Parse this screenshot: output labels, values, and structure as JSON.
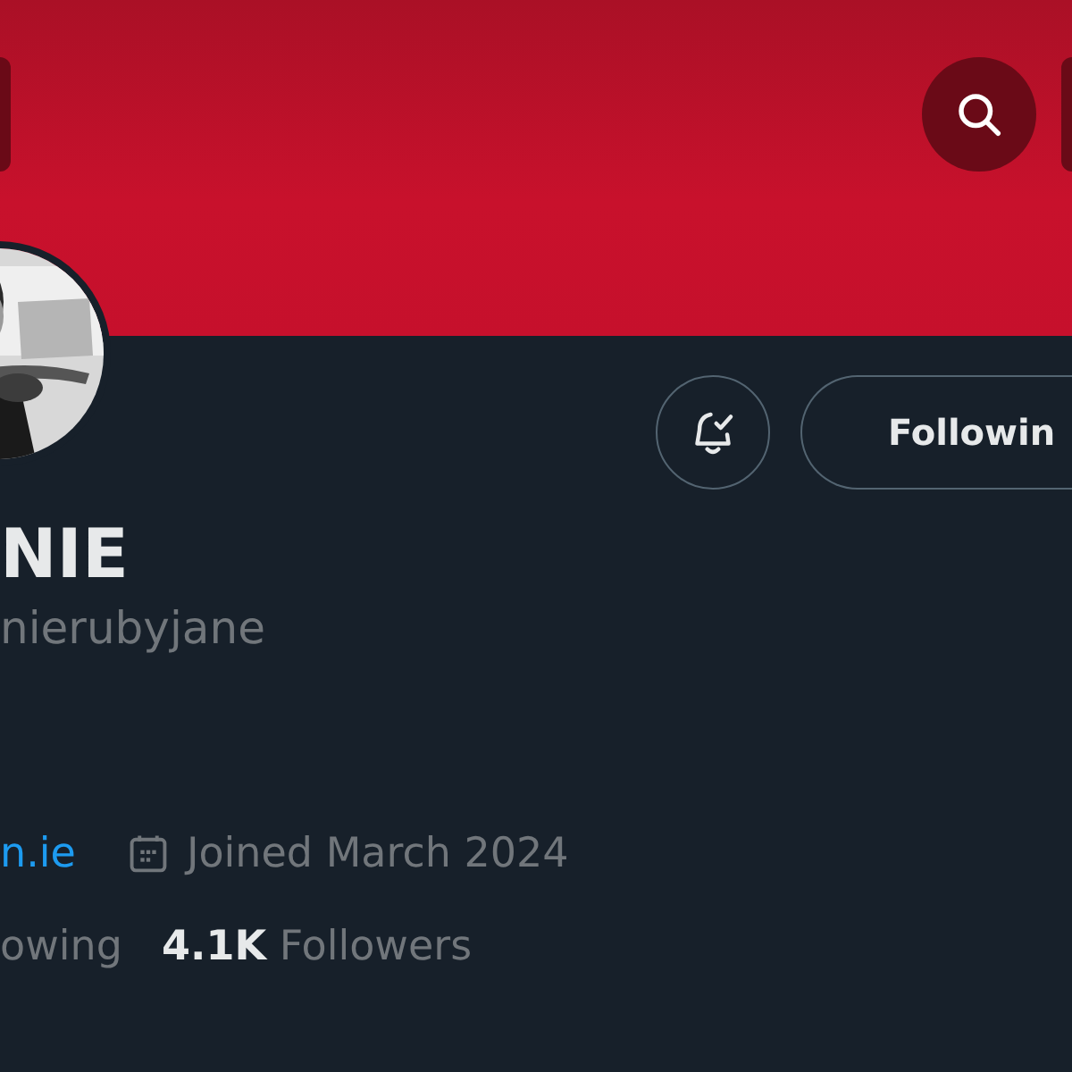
{
  "actions": {
    "notifications_on": true,
    "follow_button": "Followin"
  },
  "profile": {
    "name": "NIE",
    "handle": "nierubyjane",
    "website": "n.ie",
    "joined": "Joined March 2024"
  },
  "stats": [
    {
      "label": "owing"
    },
    {
      "count": "4.1K",
      "label": "Followers"
    }
  ]
}
